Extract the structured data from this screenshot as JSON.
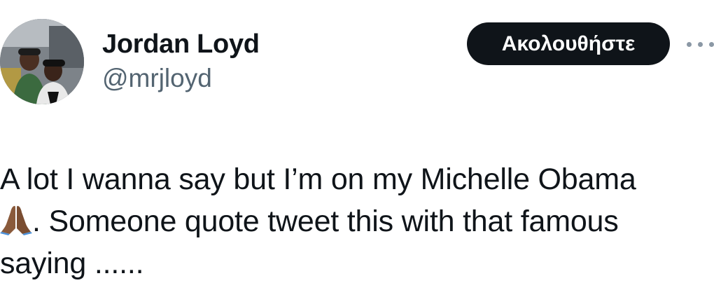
{
  "tweet": {
    "display_name": "Jordan Loyd",
    "handle": "@mrjloyd",
    "follow_label": "Ακολουθήστε",
    "text_line1": "A lot I wanna say but I’m on my Michelle Obama",
    "text_line2_after_emoji": ". Someone quote tweet this with that famous",
    "text_line3": "saying ......",
    "emoji_icon": "folded-hands-icon"
  },
  "colors": {
    "text": "#0f1419",
    "secondary_text": "#536471",
    "follow_button_bg": "#0f1419",
    "follow_button_text": "#ffffff",
    "more_dots": "#8b98a5"
  }
}
